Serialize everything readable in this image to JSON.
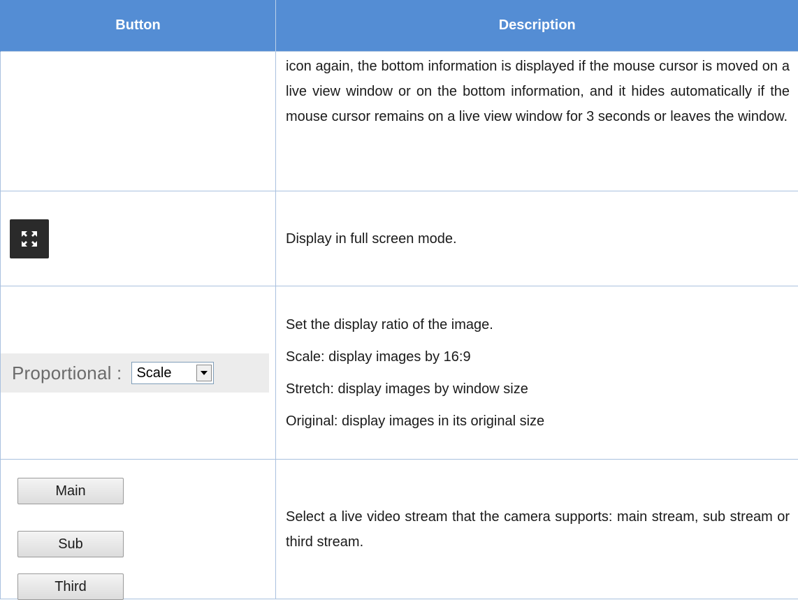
{
  "table": {
    "headers": {
      "button": "Button",
      "description": "Description"
    },
    "rows": [
      {
        "description": "icon again, the bottom information is displayed if the mouse cursor is moved on a live view window or on the bottom information, and it hides automatically if the mouse cursor remains on a live view window for 3 seconds or leaves the window."
      },
      {
        "button_icon": "fullscreen-icon",
        "description": "Display in full screen mode."
      },
      {
        "control": {
          "label": "Proportional :",
          "selected_value": "Scale"
        },
        "description_lines": [
          "Set the display ratio of the image.",
          "Scale: display images by 16:9",
          "Stretch: display images by window size",
          "Original: display images in its original size"
        ]
      },
      {
        "stream_buttons": [
          "Main",
          "Sub",
          "Third"
        ],
        "description": "Select a live video stream that the camera supports: main stream, sub stream or third stream."
      }
    ]
  },
  "colors": {
    "header_bg": "#548dd4",
    "header_text": "#ffffff",
    "border": "#a9c1df",
    "icon_bg": "#2a2a2a"
  }
}
